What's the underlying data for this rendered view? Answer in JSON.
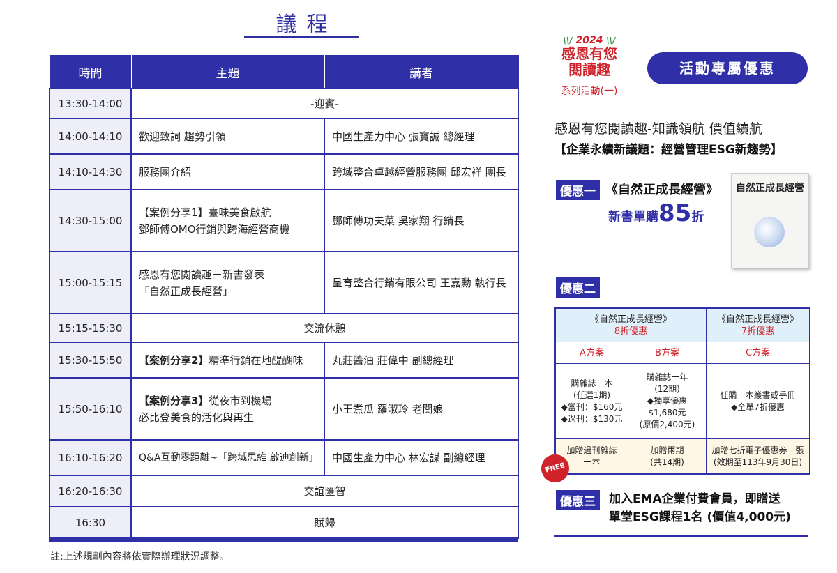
{
  "agenda": {
    "title": "議程",
    "headers": [
      "時間",
      "主題",
      "講者"
    ],
    "rows": [
      {
        "time": "13:30-14:00",
        "merged": "-迎賓-"
      },
      {
        "time": "14:00-14:10",
        "topic_lines": [
          "歡迎致詞 趨勢引領"
        ],
        "speaker": "中國生產力中心 張寶誠 總經理"
      },
      {
        "time": "14:10-14:30",
        "topic_lines": [
          "服務團介紹"
        ],
        "speaker": "跨域整合卓越經營服務團 邱宏祥 團長"
      },
      {
        "time": "14:30-15:00",
        "topic_lines": [
          "【案例分享1】臺味美食啟航",
          "鄧師傅OMO行銷與跨海經營商機"
        ],
        "speaker": "鄧師傅功夫菜 吳家翔 行銷長"
      },
      {
        "time": "15:00-15:15",
        "topic_lines": [
          "感恩有您閱讀趣－新書發表",
          "「自然正成長經營」"
        ],
        "speaker": "呈育整合行銷有限公司 王嘉勳 執行長"
      },
      {
        "time": "15:15-15:30",
        "merged": "交流休憩"
      },
      {
        "time": "15:30-15:50",
        "topic_bold": "【案例分享2】",
        "topic_rest": "精準行銷在地醍醐味",
        "speaker": "丸莊醬油 莊偉中 副總經理"
      },
      {
        "time": "15:50-16:10",
        "topic_bold": "【案例分享3】",
        "topic_rest": "從夜市到機場",
        "topic_line2": "必比登美食的活化與再生",
        "speaker": "小王煮瓜 羅淑玲 老闆娘"
      },
      {
        "time": "16:10-16:20",
        "topic_lines": [
          "Q&A互動零距離~「跨域思維 啟迪創新」"
        ],
        "speaker": "中國生產力中心 林宏謀 副總經理"
      },
      {
        "time": "16:20-16:30",
        "merged": "交誼匯智"
      },
      {
        "time": "16:30",
        "merged": "賦歸"
      }
    ],
    "note": "註:上述規劃內容將依實際辦理狀況調整。"
  },
  "logo": {
    "year": "2024",
    "line1": "感恩有您",
    "line2": "閱讀趣",
    "series": "系列活動(一)"
  },
  "promo": {
    "pill": "活動專屬優惠",
    "event_title": "感恩有您閱讀趣-知識領航 價值續航",
    "event_subtitle": "【企業永續新議題：經營管理ESG新趨勢】",
    "p1_tag": "優惠一",
    "p1_book": "《自然正成長經營》",
    "p1_price_prefix": "新書單購",
    "p1_price_num": "85",
    "p1_price_suffix": "折",
    "book_cover_title": "自然正成長經營",
    "p2_tag": "優惠二",
    "offer": {
      "hdr_left_title": "《自然正成長經營》",
      "hdr_left_discount": "8折優惠",
      "hdr_right_title": "《自然正成長經營》",
      "hdr_right_discount": "7折優惠",
      "plan_a": "A方案",
      "plan_b": "B方案",
      "plan_c": "C方案",
      "a_lines": [
        "購雜誌一本",
        "(任選1期)",
        "◆當刊：$160元",
        "◆過刊：$130元"
      ],
      "b_lines": [
        "購雜誌一年",
        "(12期)",
        "◆獨享優惠",
        "$1,680元",
        "(原價2,400元)"
      ],
      "c_lines": [
        "任購一本叢書或手冊",
        "◆全單7折優惠"
      ],
      "bonus_a": [
        "加贈過刊雜誌",
        "一本"
      ],
      "bonus_b": [
        "加贈兩期",
        "(共14期)"
      ],
      "bonus_c": [
        "加贈七折電子優惠券一張",
        "(效期至113年9月30日)"
      ],
      "free_badge": "FREE"
    },
    "p3_tag": "優惠三",
    "p3_line1": "加入EMA企業付費會員，即贈送",
    "p3_line2": "單堂ESG課程1名 (價值4,000元)"
  },
  "colors": {
    "brand": "#2f2fa8",
    "accent_red": "#d0222a"
  }
}
